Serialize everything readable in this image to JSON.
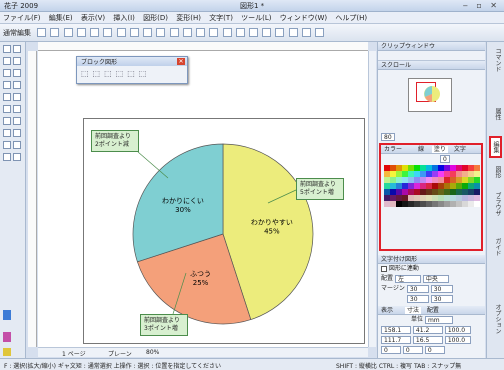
{
  "app": {
    "title": "花子 2009",
    "document": "図形1 *"
  },
  "menu": [
    "ファイル(F)",
    "編集(E)",
    "表示(V)",
    "挿入(I)",
    "図形(D)",
    "変形(H)",
    "文字(T)",
    "ツール(L)",
    "ウィンドウ(W)",
    "ヘルプ(H)"
  ],
  "toolbar": {
    "mode_label": "通常編集"
  },
  "float_panel": {
    "title": "ブロック図形"
  },
  "chart_data": {
    "type": "pie",
    "slices": [
      {
        "label": "わかりやすい",
        "percent_label": "45%",
        "value": 45,
        "color": "#ecec7c"
      },
      {
        "label": "ふつう",
        "percent_label": "25%",
        "value": 25,
        "color": "#f4a07a"
      },
      {
        "label": "わかりにくい",
        "percent_label": "30%",
        "value": 30,
        "color": "#7fcfd2"
      }
    ]
  },
  "callouts": {
    "top_left": "前回調査より\n2ポイント減",
    "right": "前回調査より\n5ポイント増",
    "bottom": "前回調査より\n3ポイント増"
  },
  "right_panel": {
    "header": "クリップウィンドウ",
    "scroll_label": "スクロール",
    "zoom_value": "80",
    "color_section": {
      "title": "カラー",
      "tab_line": "線",
      "tab_fill": "塗り",
      "tab_text": "文字",
      "value": "0"
    },
    "text_section": {
      "title": "文字付け図形",
      "link_label": "図形に連動",
      "align_label": "配置",
      "align_value": "左",
      "align_value2": "中央",
      "margin_label": "マージン",
      "m1": "30",
      "m2": "30",
      "m3": "30",
      "m4": "30"
    },
    "size_section": {
      "tab1": "表示",
      "tab2": "寸法",
      "tab3": "配置",
      "unit_label": "単位",
      "unit_value": "mm",
      "x": "158.1",
      "w": "41.2",
      "w_pct": "100.0",
      "y": "111.7",
      "h": "16.5",
      "h_pct": "100.0",
      "rot": "0",
      "rot2": "0",
      "rot3": "0"
    }
  },
  "vertical_tabs": [
    "コマンド",
    "属性",
    "編集",
    "図形",
    "ブラウザ",
    "ガイド",
    "オプション"
  ],
  "scroll_bar": {
    "page_label": "1 ページ",
    "layer_label": "プレーン",
    "zoom": "80%"
  },
  "status": {
    "left": "F : 選択(拡大/縮小) ギャ文矩 : 通常選択 上操作 : 選択 : 位置を指定してください",
    "right": "SHIFT : 縦横比 CTRL : 複写 TAB : スナップ無"
  }
}
